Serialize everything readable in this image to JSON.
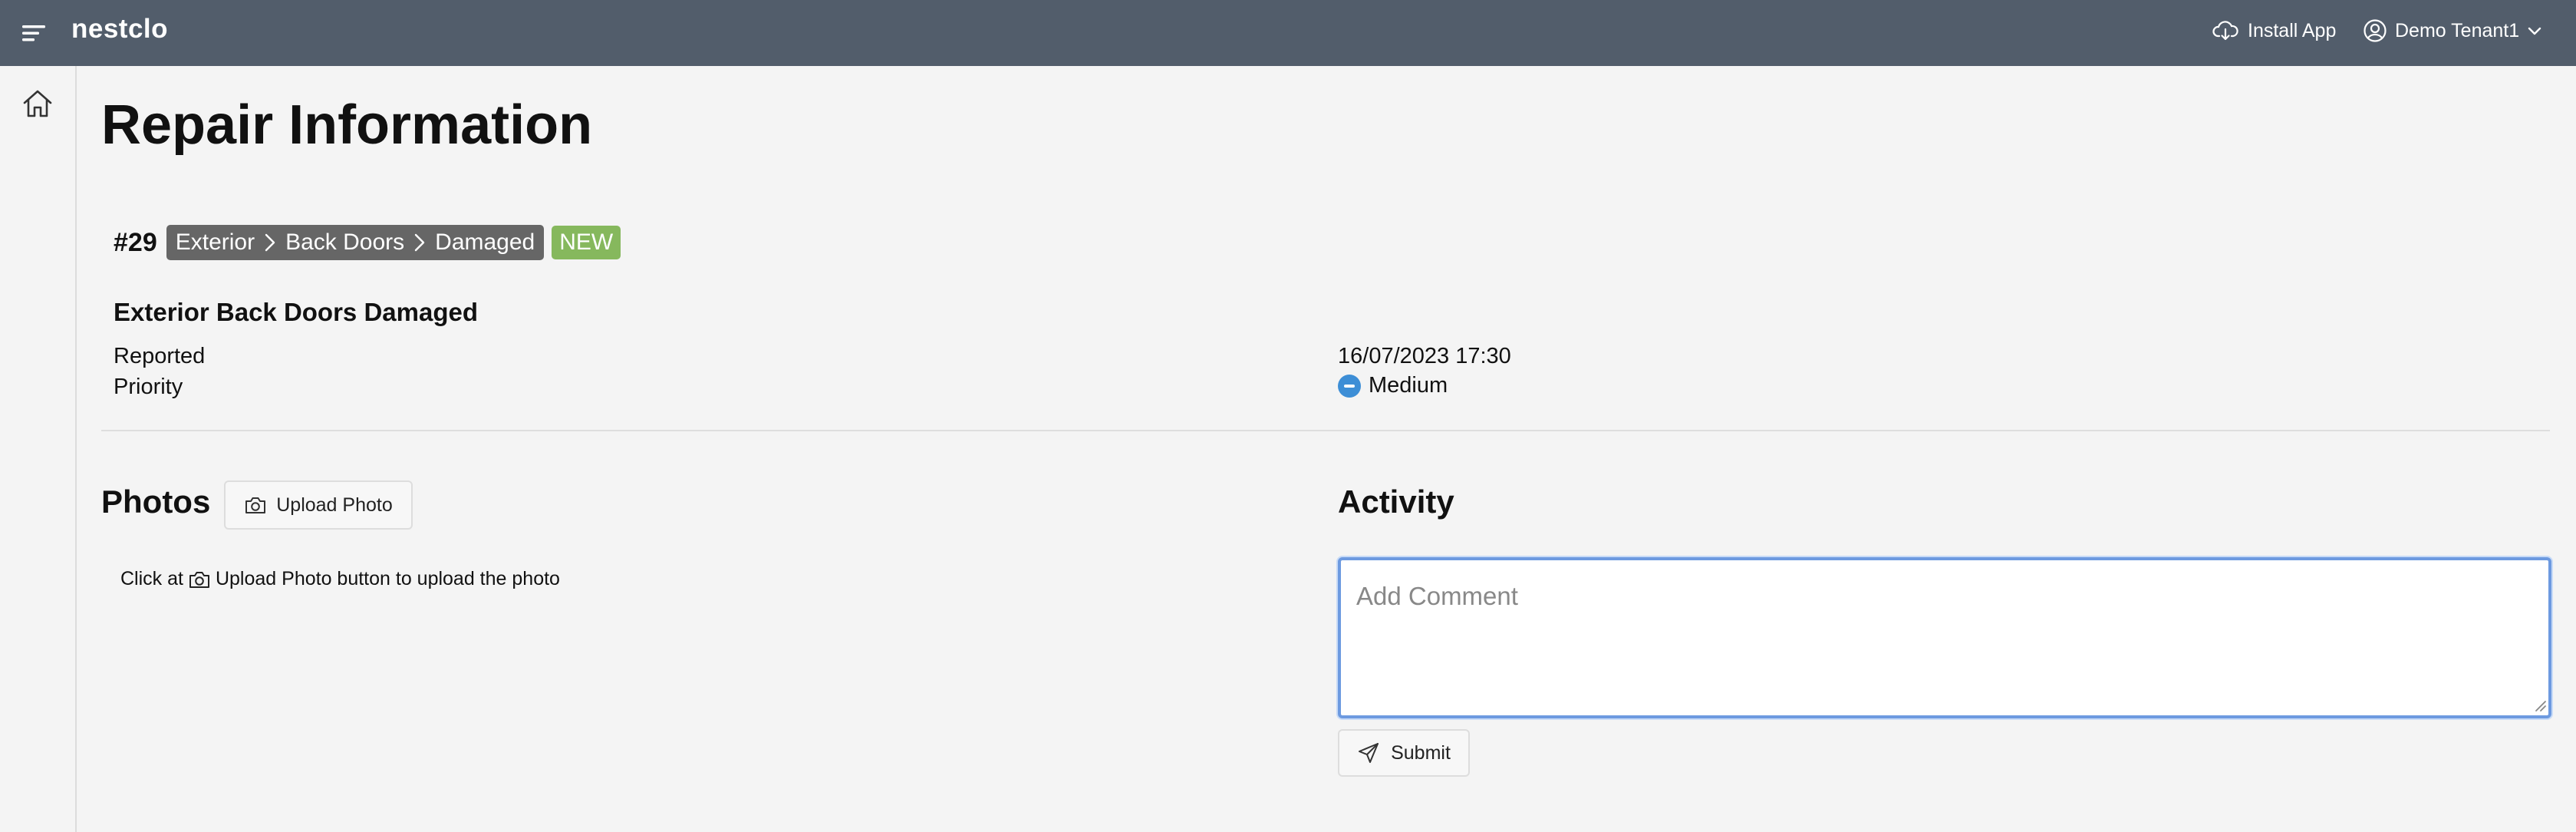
{
  "app": {
    "brand": "nestclo",
    "install_label": "Install App",
    "tenant_label": "Demo Tenant1"
  },
  "icons": {
    "menu": "menu-icon",
    "cloud_download": "cloud-download-icon",
    "user": "user-circle-icon",
    "chevron": "chevron-down-icon",
    "home": "home-icon",
    "camera": "camera-icon",
    "send": "send-icon"
  },
  "page": {
    "title": "Repair Information"
  },
  "ticket": {
    "number": "#29",
    "breadcrumb": [
      "Exterior",
      "Back Doors",
      "Damaged"
    ],
    "status": "NEW",
    "status_color": "#86b85d",
    "title": "Exterior Back Doors Damaged",
    "reported_label": "Reported",
    "reported_value": "16/07/2023 17:30",
    "priority_label": "Priority",
    "priority_value": "Medium",
    "priority_color": "#3d8ed6"
  },
  "photos": {
    "heading": "Photos",
    "upload_label": "Upload Photo",
    "hint_prefix": "Click at",
    "hint_suffix": "Upload Photo button to upload the photo"
  },
  "activity": {
    "heading": "Activity",
    "comment_placeholder": "Add Comment",
    "comment_value": "",
    "submit_label": "Submit"
  }
}
